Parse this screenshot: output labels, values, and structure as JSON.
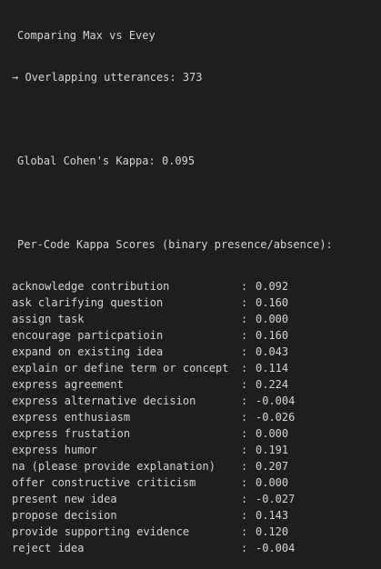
{
  "header": {
    "comparing": "Comparing Max vs Evey",
    "arrow": "→",
    "overlap_label": "Overlapping utterances: 373",
    "global_kappa": "Global Cohen's Kappa: 0.095",
    "per_code_title": "Per-Code Kappa Scores (binary presence/absence):"
  },
  "separator": ":",
  "kappa_rows": [
    {
      "code": "acknowledge contribution",
      "score": "0.092"
    },
    {
      "code": "ask clarifying question",
      "score": "0.160"
    },
    {
      "code": "assign task",
      "score": "0.000"
    },
    {
      "code": "encourage particpatioin",
      "score": "0.160"
    },
    {
      "code": "expand on existing idea",
      "score": "0.043"
    },
    {
      "code": "explain or define term or concept",
      "score": "0.114"
    },
    {
      "code": "express agreement",
      "score": "0.224"
    },
    {
      "code": "express alternative decision",
      "score": "-0.004"
    },
    {
      "code": "express enthusiasm",
      "score": "-0.026"
    },
    {
      "code": "express frustation",
      "score": "0.000"
    },
    {
      "code": "express humor",
      "score": "0.191"
    },
    {
      "code": "na (please provide explanation)",
      "score": "0.207"
    },
    {
      "code": "offer constructive criticism",
      "score": "0.000"
    },
    {
      "code": "present new idea",
      "score": "-0.027"
    },
    {
      "code": "propose decision",
      "score": "0.143"
    },
    {
      "code": "provide supporting evidence",
      "score": "0.120"
    },
    {
      "code": "reject idea",
      "score": "-0.004"
    }
  ]
}
